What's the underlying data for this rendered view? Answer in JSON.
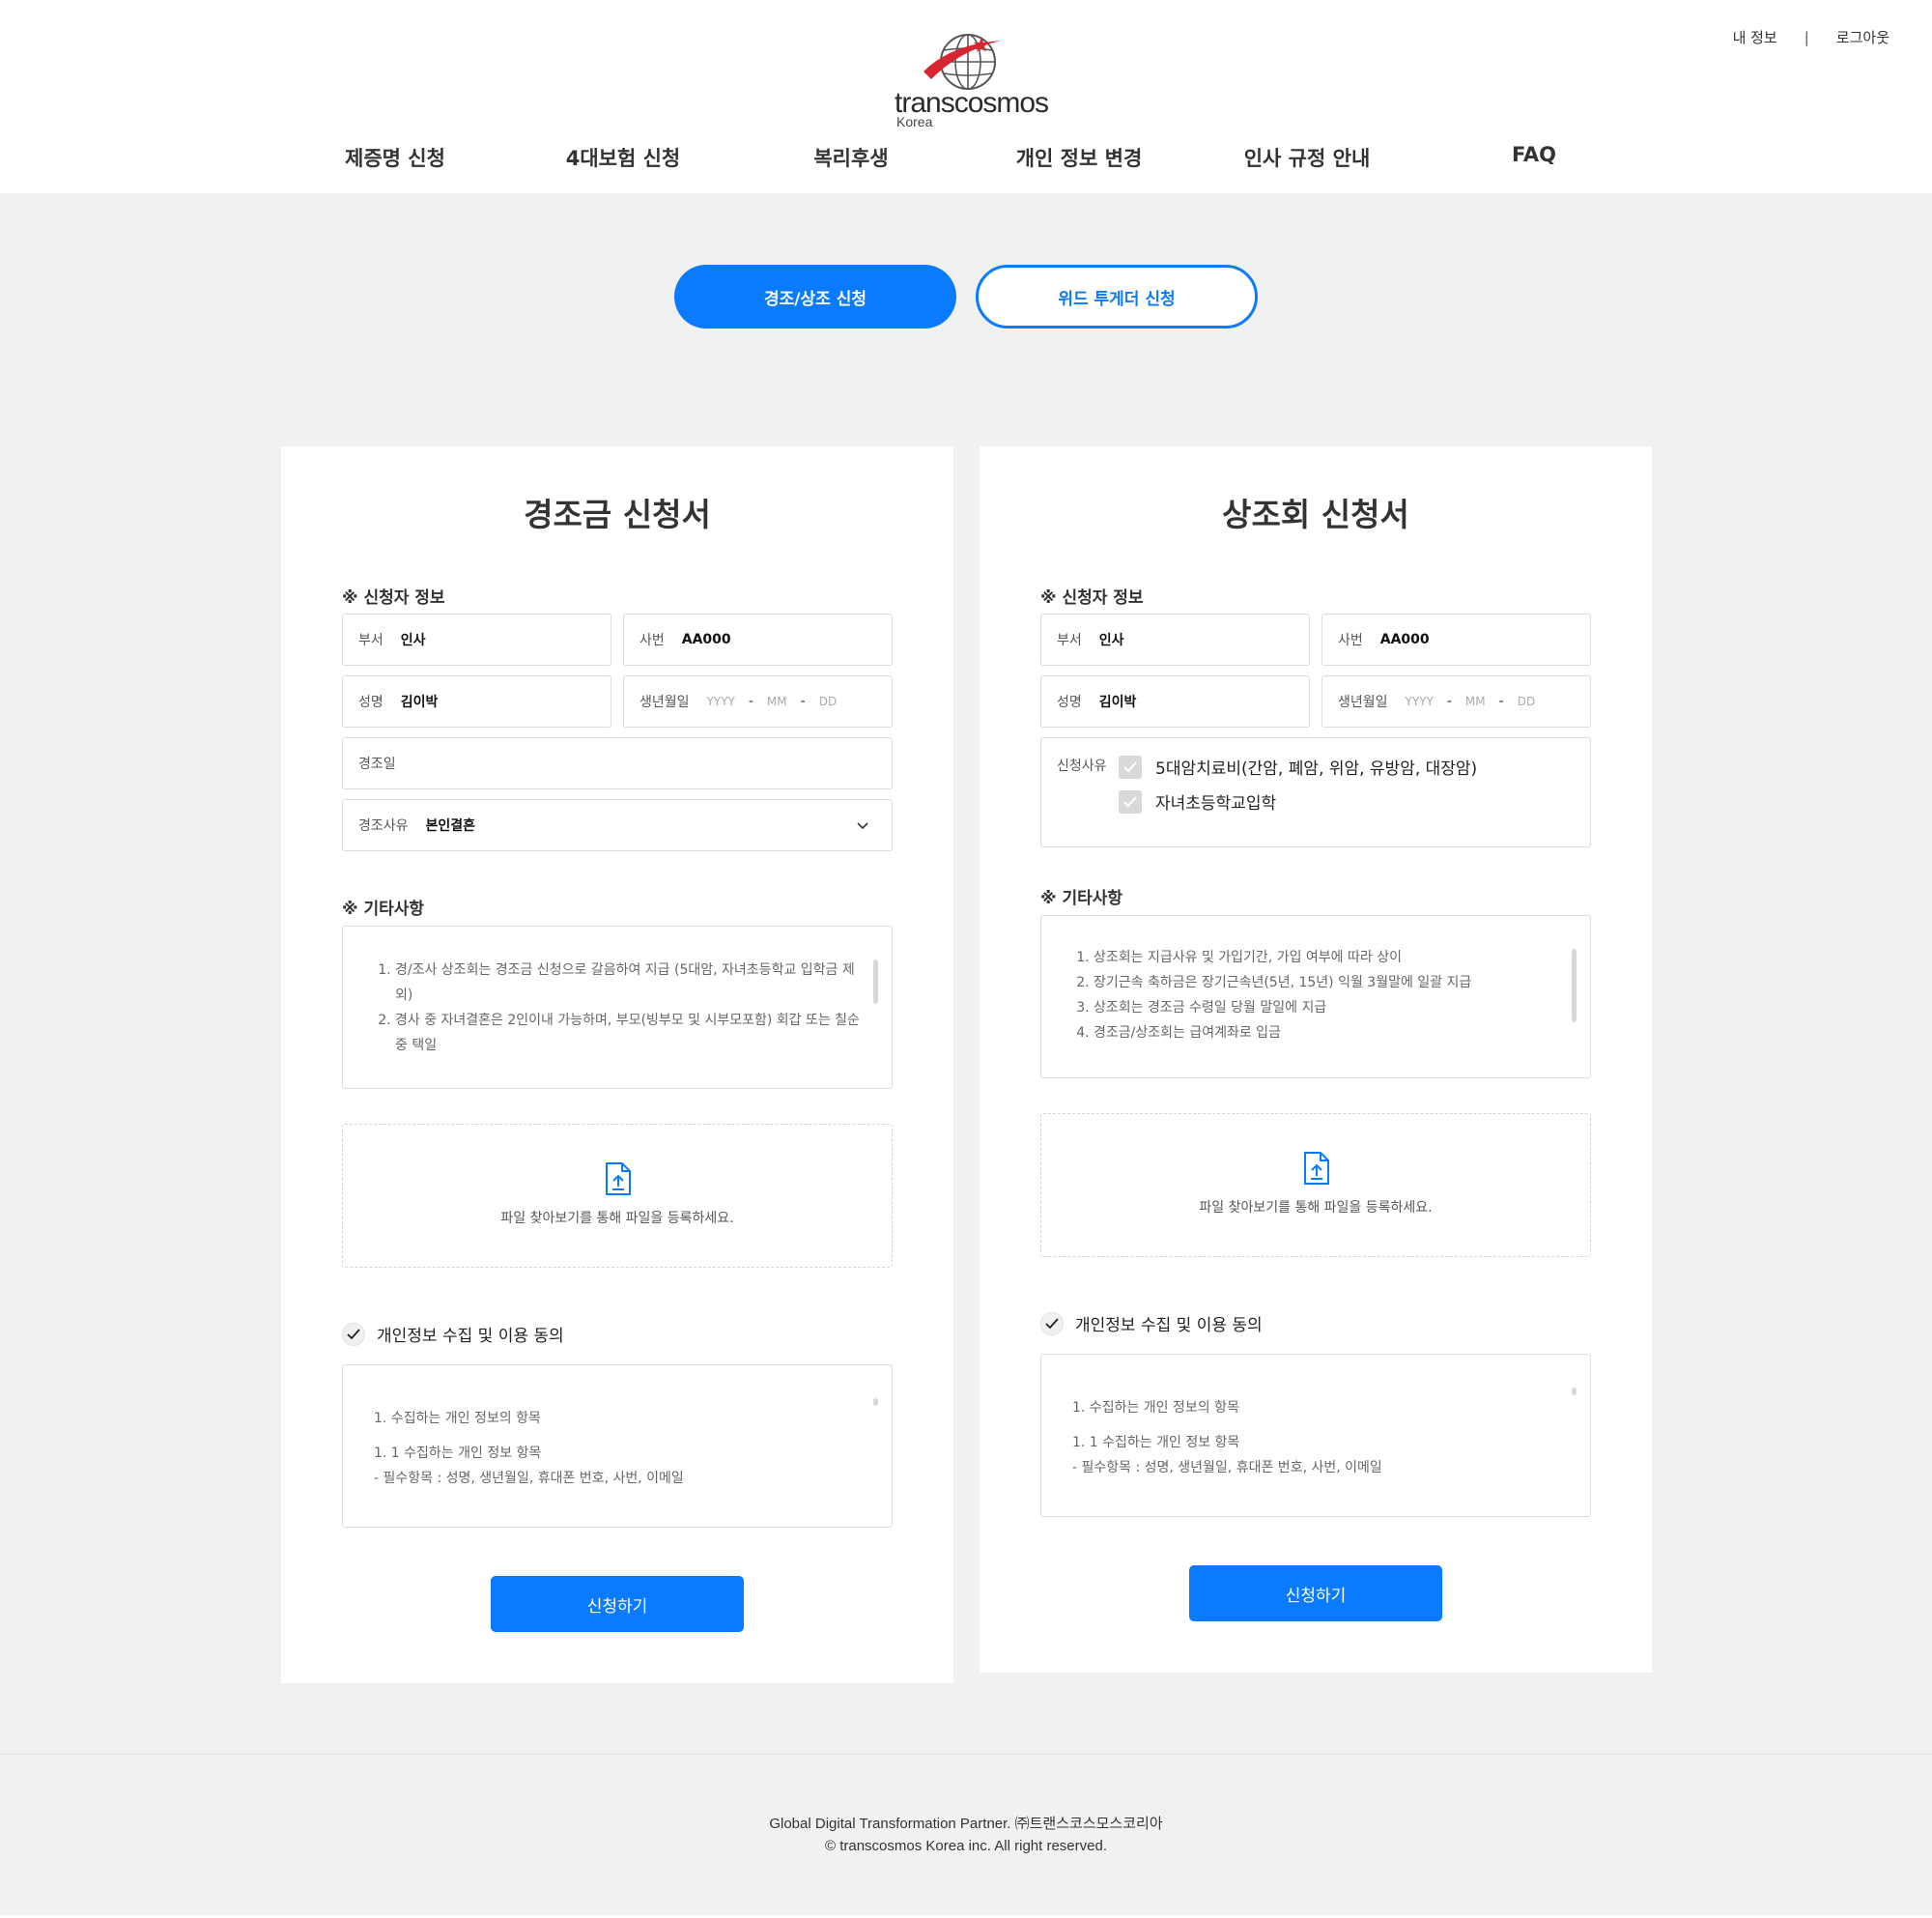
{
  "header": {
    "my_info": "내 정보",
    "separator": "|",
    "logout": "로그아웃",
    "logo_word": "transcosmos",
    "logo_sub": "Korea",
    "nav": [
      "제증명 신청",
      "4대보험 신청",
      "복리후생",
      "개인 정보 변경",
      "인사 규정 안내",
      "FAQ"
    ]
  },
  "tabs": {
    "active": "경조/상조 신청",
    "inactive": "위드 투게더 신청"
  },
  "left_form": {
    "title": "경조금 신청서",
    "applicant_section": "※ 신청자 정보",
    "dept_label": "부서",
    "dept_value": "인사",
    "emp_label": "사번",
    "emp_value": "AA000",
    "name_label": "성명",
    "name_value": "김이박",
    "birth_label": "생년월일",
    "birth_yyyy": "YYYY",
    "birth_mm": "MM",
    "birth_dd": "DD",
    "birth_dash": "-",
    "event_date_label": "경조일",
    "reason_label": "경조사유",
    "reason_value": "본인결혼",
    "notes_section": "※ 기타사항",
    "notes": [
      "경/조사 상조회는 경조금 신청으로 갈음하여 지급 (5대암, 자녀초등학교 입학금 제외)",
      "경사 중 자녀결혼은 2인이내 가능하며, 부모(빙부모 및 시부모포함) 회갑 또는 칠순 중 택일"
    ],
    "upload_text": "파일 찾아보기를 통해 파일을 등록하세요.",
    "agree_label": "개인정보 수집 및 이용 동의",
    "privacy_lines": [
      "1. 수집하는 개인 정보의 항목",
      "1. 1 수집하는 개인 정보 항목",
      "- 필수항목 : 성명, 생년월일, 휴대폰 번호, 사번, 이메일"
    ],
    "submit": "신청하기"
  },
  "right_form": {
    "title": "상조회 신청서",
    "applicant_section": "※ 신청자 정보",
    "dept_label": "부서",
    "dept_value": "인사",
    "emp_label": "사번",
    "emp_value": "AA000",
    "name_label": "성명",
    "name_value": "김이박",
    "birth_label": "생년월일",
    "birth_yyyy": "YYYY",
    "birth_mm": "MM",
    "birth_dd": "DD",
    "birth_dash": "-",
    "reason_label": "신청사유",
    "reason_options": [
      "5대암치료비(간암, 폐암, 위암, 유방암, 대장암)",
      "자녀초등학교입학"
    ],
    "notes_section": "※ 기타사항",
    "notes": [
      "상조회는 지급사유 및 가입기간, 가입 여부에 따라 상이",
      "장기근속 축하금은 장기근속년(5년, 15년) 익월 3월말에 일괄 지급",
      "상조회는 경조금 수령일 당월 말일에 지급",
      "경조금/상조회는 급여계좌로 입금"
    ],
    "upload_text": "파일 찾아보기를 통해 파일을 등록하세요.",
    "agree_label": "개인정보 수집 및 이용 동의",
    "privacy_lines": [
      "1. 수집하는 개인 정보의 항목",
      "1. 1 수집하는 개인 정보 항목",
      "- 필수항목 : 성명, 생년월일, 휴대폰 번호, 사번, 이메일"
    ],
    "submit": "신청하기"
  },
  "footer": {
    "line1": "Global Digital Transformation Partner. ㈜트랜스코스모스코리아",
    "line2": "© transcosmos Korea inc. All right reserved."
  },
  "colors": {
    "accent": "#0a7bff",
    "logo_red": "#d7262f",
    "background": "#f1f1f1"
  }
}
